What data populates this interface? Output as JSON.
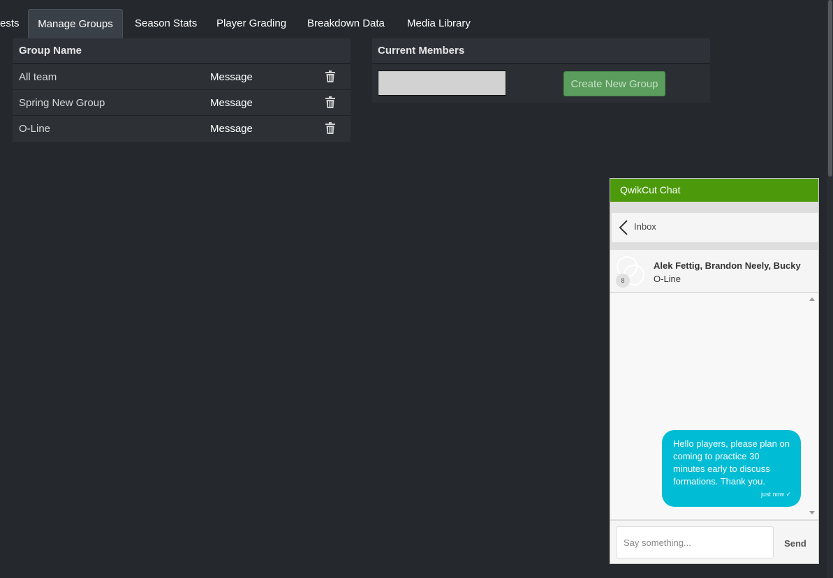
{
  "tabs": [
    {
      "label": "ests",
      "active": false
    },
    {
      "label": "Manage Groups",
      "active": true
    },
    {
      "label": "Season Stats",
      "active": false
    },
    {
      "label": "Player Grading",
      "active": false
    },
    {
      "label": "Breakdown Data",
      "active": false
    },
    {
      "label": "Media Library",
      "active": false
    }
  ],
  "groups_table": {
    "header": "Group Name",
    "rows": [
      {
        "name": "All team",
        "action": "Message",
        "delete_icon": "trash-icon"
      },
      {
        "name": "Spring New Group",
        "action": "Message",
        "delete_icon": "trash-icon"
      },
      {
        "name": "O-Line",
        "action": "Message",
        "delete_icon": "trash-icon"
      }
    ]
  },
  "members_panel": {
    "header": "Current Members",
    "input_value": "",
    "create_button": "Create New Group"
  },
  "chat": {
    "title": "QwikCut Chat",
    "back_icon": "chevron-left-icon",
    "inbox_label": "Inbox",
    "conversation": {
      "participants": "Alek Fettig, Brandon Neely, Bucky",
      "group": "O-Line",
      "member_count": "8"
    },
    "messages": [
      {
        "text": "Hello players, please plan on coming to practice 30 minutes early to discuss formations. Thank you.",
        "meta": "just now ✓"
      }
    ],
    "composer_placeholder": "Say something...",
    "send_label": "Send"
  },
  "colors": {
    "page_bg": "#25282d",
    "chat_header": "#4c9a0c",
    "bubble": "#00bcd4",
    "create_button": "#5a9d5c"
  }
}
